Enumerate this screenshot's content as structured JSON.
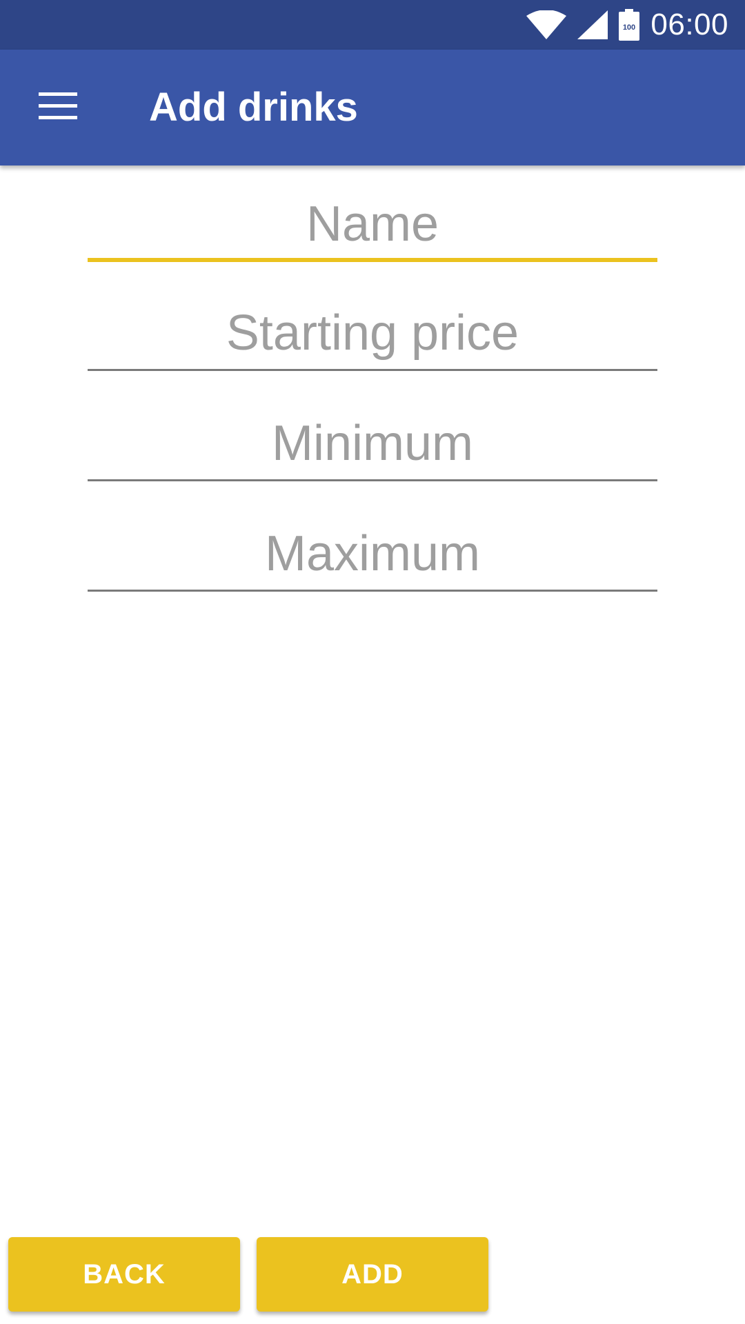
{
  "status_bar": {
    "time": "06:00",
    "battery_level": "100",
    "icons": [
      "wifi-icon",
      "cellular-signal-icon",
      "battery-icon"
    ]
  },
  "app_bar": {
    "menu_icon": "hamburger-menu-icon",
    "title": "Add drinks"
  },
  "form": {
    "name": {
      "placeholder": "Name",
      "value": "",
      "focused": true
    },
    "starting_price": {
      "placeholder": "Starting price",
      "value": ""
    },
    "minimum": {
      "placeholder": "Minimum",
      "value": ""
    },
    "maximum": {
      "placeholder": "Maximum",
      "value": ""
    }
  },
  "buttons": {
    "back_label": "BACK",
    "add_label": "ADD"
  },
  "colors": {
    "status_bar": "#2e4587",
    "app_bar": "#3a56a7",
    "accent": "#ebc21f",
    "placeholder": "#9e9e9e",
    "underline": "#7a7a7a"
  }
}
